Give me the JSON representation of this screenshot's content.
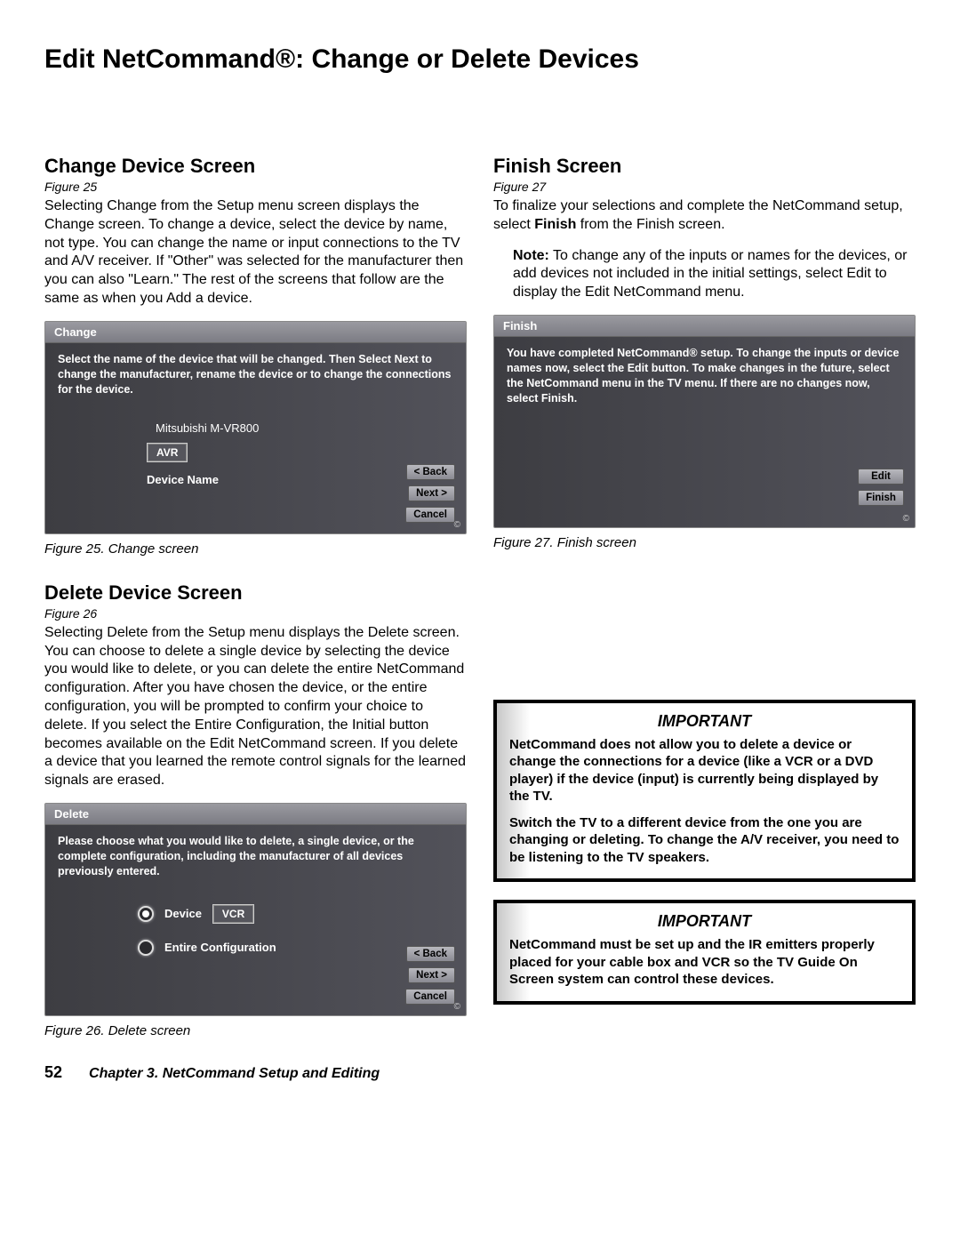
{
  "pageTitle": "Edit NetCommand®:  Change or Delete Devices",
  "left": {
    "change": {
      "heading": "Change Device Screen",
      "figref": "Figure 25",
      "body": "Selecting Change from the Setup menu screen displays the Change screen.  To change a device, select the device by name, not type.  You can change the name or input connections to the TV and A/V receiver.  If \"Other\" was selected for the manufacturer then you can also \"Learn.\"  The rest of the screens that follow are the same as when you Add a device.",
      "panel": {
        "title": "Change",
        "instruction": "Select the name of the device that will be changed.  Then Select Next to change the manufacturer, rename the device or to change the connections for the device.",
        "deviceLine": "Mitsubishi M-VR800",
        "avr": "AVR",
        "deviceNameLabel": "Device Name",
        "buttons": {
          "back": "< Back",
          "next": "Next >",
          "cancel": "Cancel"
        }
      },
      "caption": "Figure 25. Change screen"
    },
    "delete": {
      "heading": "Delete Device Screen",
      "figref": "Figure 26",
      "body": "Selecting Delete from the Setup menu displays the Delete screen.  You can choose to delete a single device by selecting the device you would like to delete, or you can delete the entire NetCommand configuration.  After you have chosen the device, or the entire configuration, you will be prompted to confirm your choice to delete.  If you select the Entire Configuration, the Initial button becomes available on the Edit NetCommand screen.  If you delete a device that you learned the remote control signals for the learned signals are erased.",
      "panel": {
        "title": "Delete",
        "instruction": "Please choose what you would like to delete, a single device, or the complete configuration, including the manufacturer of all devices previously entered.",
        "deviceLabel": "Device",
        "deviceValue": "VCR",
        "entireLabel": "Entire Configuration",
        "buttons": {
          "back": "< Back",
          "next": "Next >",
          "cancel": "Cancel"
        }
      },
      "caption": "Figure 26. Delete screen"
    }
  },
  "right": {
    "finish": {
      "heading": "Finish Screen",
      "figref": "Figure 27",
      "body1a": "To finalize your selections and complete the NetCommand setup, select ",
      "body1bold": "Finish",
      "body1b": " from the Finish screen.",
      "noteBold": "Note:",
      "noteText": "  To change any of the inputs or names for the devices, or add devices not included in the initial settings, select Edit to display the Edit NetCommand menu.",
      "panel": {
        "title": "Finish",
        "instruction": "You have completed NetCommand® setup.  To change the inputs or device names now, select the Edit button.  To make changes in the future, select the NetCommand menu in the TV menu.  If there are no changes now, select Finish.",
        "buttons": {
          "edit": "Edit",
          "finish": "Finish"
        }
      },
      "caption": "Figure 27. Finish screen"
    },
    "important1": {
      "title": "IMPORTANT",
      "p1": "NetCommand does not allow you to delete a device or change the connections for a device (like a VCR or a DVD player) if the device (input) is currently being displayed by the TV.",
      "p2": "Switch the TV to a different device from the one you are changing or deleting.  To change the A/V receiver, you need to be listening to the TV speakers."
    },
    "important2": {
      "title": "IMPORTANT",
      "p1": "NetCommand must be set up and the IR emitters properly placed for your cable box and VCR so the TV Guide On Screen system can control these devices."
    }
  },
  "footer": {
    "page": "52",
    "chapter": "Chapter 3. NetCommand Setup and Editing"
  }
}
